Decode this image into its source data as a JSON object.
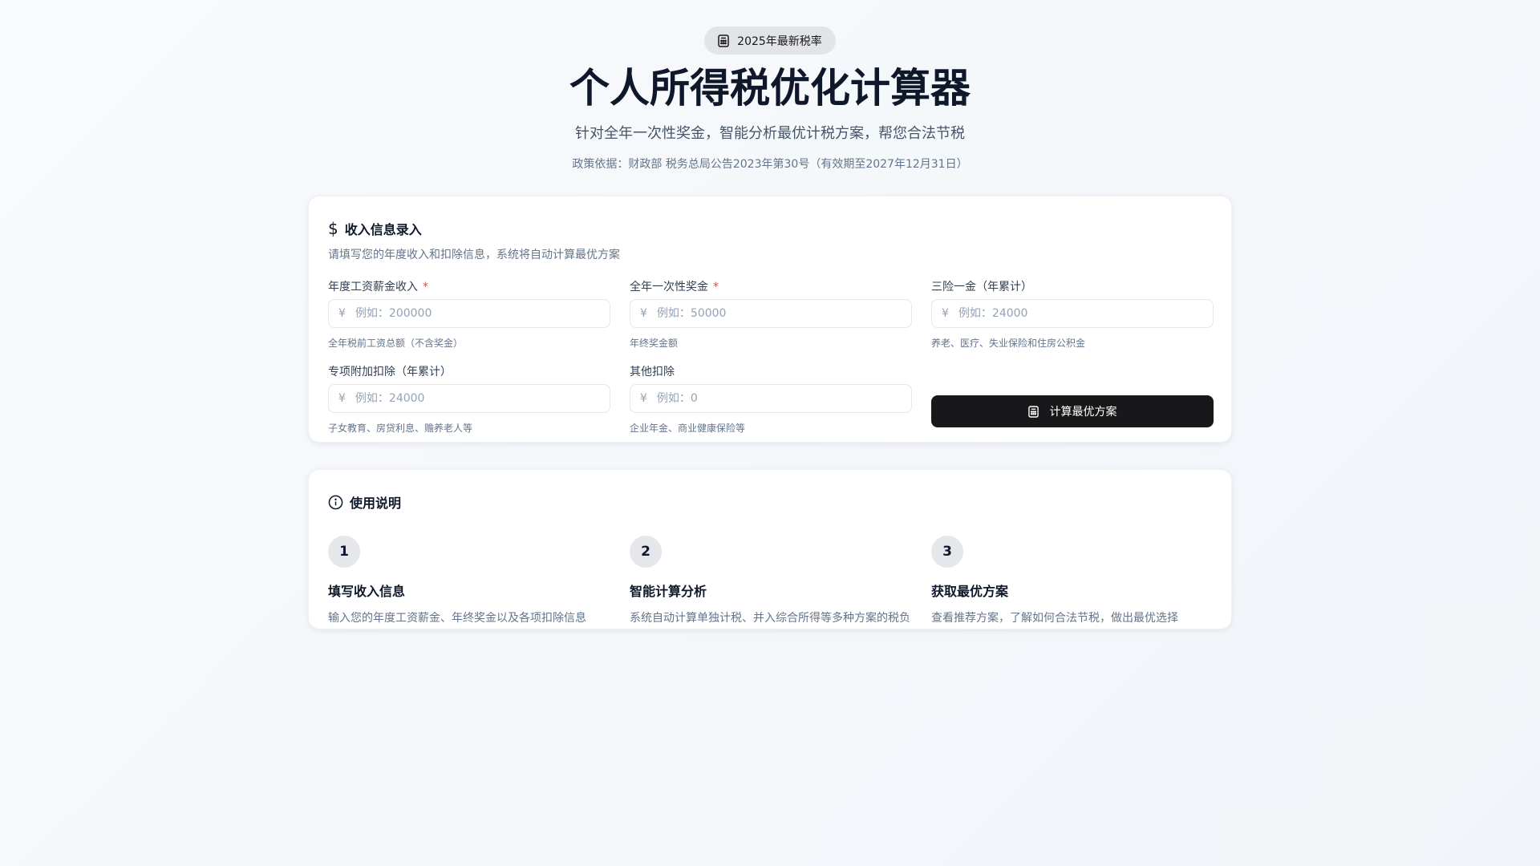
{
  "header": {
    "badge": "2025年最新税率",
    "title": "个人所得税优化计算器",
    "subtitle": "针对全年一次性奖金，智能分析最优计税方案，帮您合法节税",
    "policy": "政策依据：财政部 税务总局公告2023年第30号（有效期至2027年12月31日）"
  },
  "form": {
    "title": "收入信息录入",
    "description": "请填写您的年度收入和扣除信息，系统将自动计算最优方案",
    "currency": "¥",
    "fields": [
      {
        "label": "年度工资薪金收入",
        "required": "*",
        "placeholder": "例如：200000",
        "help": "全年税前工资总额（不含奖金）"
      },
      {
        "label": "全年一次性奖金",
        "required": "*",
        "placeholder": "例如：50000",
        "help": "年终奖金额"
      },
      {
        "label": "三险一金（年累计）",
        "placeholder": "例如：24000",
        "help": "养老、医疗、失业保险和住房公积金"
      },
      {
        "label": "专项附加扣除（年累计）",
        "placeholder": "例如：24000",
        "help": "子女教育、房贷利息、赡养老人等"
      },
      {
        "label": "其他扣除",
        "placeholder": "例如：0",
        "help": "企业年金、商业健康保险等"
      }
    ],
    "submit_label": "计算最优方案"
  },
  "guide": {
    "title": "使用说明",
    "steps": [
      {
        "num": "1",
        "title": "填写收入信息",
        "desc": "输入您的年度工资薪金、年终奖金以及各项扣除信息"
      },
      {
        "num": "2",
        "title": "智能计算分析",
        "desc": "系统自动计算单独计税、并入综合所得等多种方案的税负"
      },
      {
        "num": "3",
        "title": "获取最优方案",
        "desc": "查看推荐方案，了解如何合法节税，做出最优选择"
      }
    ]
  }
}
